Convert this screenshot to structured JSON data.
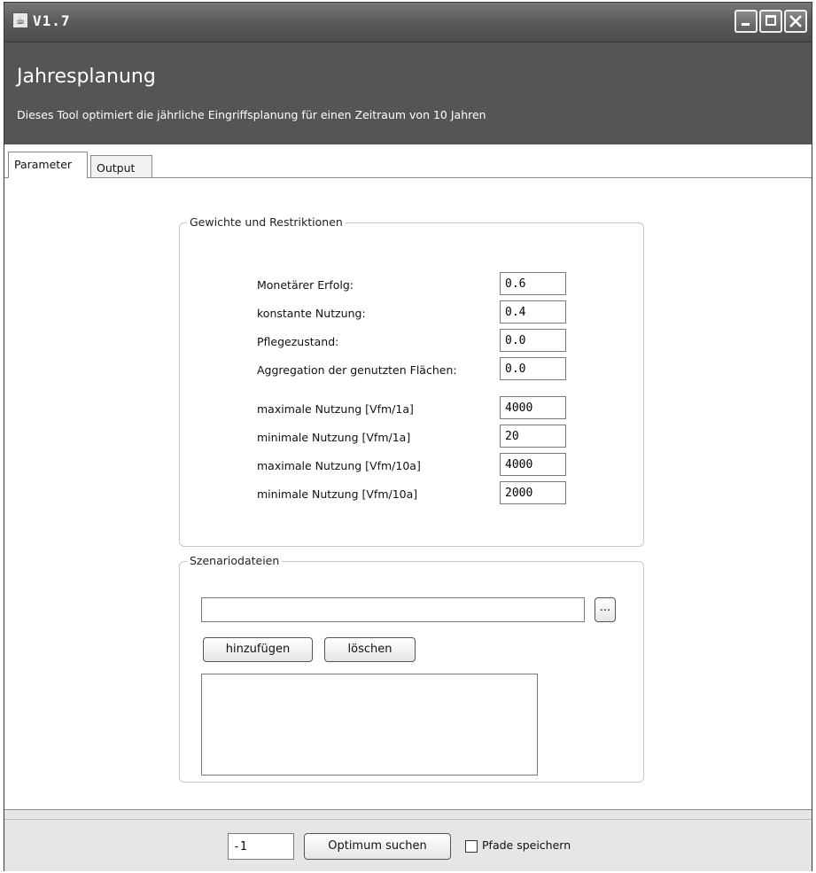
{
  "window": {
    "title": "V1.7",
    "app_icon": "java-cup-icon"
  },
  "header": {
    "title": "Jahresplanung",
    "description": "Dieses Tool optimiert die jährliche Eingriffsplanung für einen Zeitraum von 10 Jahren"
  },
  "tabs": [
    {
      "label": "Parameter",
      "active": true
    },
    {
      "label": "Output",
      "active": false
    }
  ],
  "weights_group": {
    "title": "Gewichte und Restriktionen",
    "fields": [
      {
        "label": "Monetärer Erfolg:",
        "value": "0.6"
      },
      {
        "label": "konstante Nutzung:",
        "value": "0.4"
      },
      {
        "label": "Pflegezustand:",
        "value": "0.0"
      },
      {
        "label": "Aggregation der genutzten Flächen:",
        "value": "0.0"
      },
      {
        "label": "maximale Nutzung [Vfm/1a]",
        "value": "4000"
      },
      {
        "label": "minimale Nutzung [Vfm/1a]",
        "value": "20"
      },
      {
        "label": "maximale Nutzung [Vfm/10a]",
        "value": "4000"
      },
      {
        "label": "minimale Nutzung [Vfm/10a]",
        "value": "2000"
      }
    ]
  },
  "scenario_group": {
    "title": "Szenariodateien",
    "path_value": "",
    "browse_label": "...",
    "add_label": "hinzufügen",
    "delete_label": "löschen"
  },
  "bottom": {
    "iterations_value": "-1",
    "search_label": "Optimum suchen",
    "save_paths_label": "Pfade speichern",
    "save_paths_checked": false
  }
}
